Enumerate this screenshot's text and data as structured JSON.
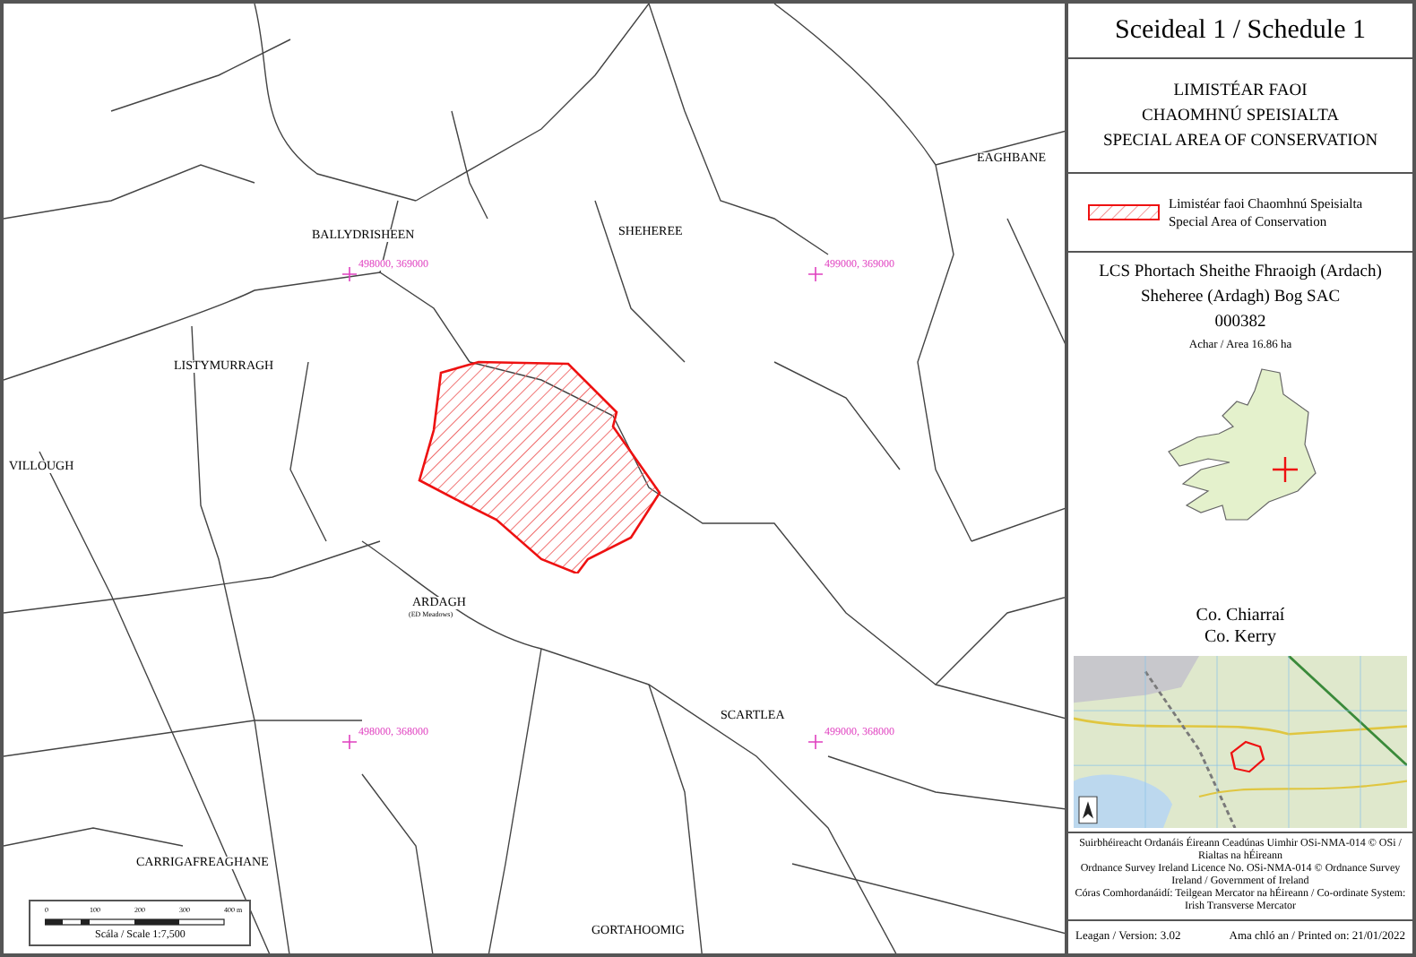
{
  "map": {
    "place_labels": [
      {
        "text": "EAGHBANE"
      },
      {
        "text": "BALLYDRISHEEN"
      },
      {
        "text": "SHEHEREE"
      },
      {
        "text": "LISTYMURRAGH"
      },
      {
        "text": "VILLOUGH"
      },
      {
        "text": "ARDAGH"
      },
      {
        "text": "(ED Meadows)"
      },
      {
        "text": "SCARTLEA"
      },
      {
        "text": "CARRIGAFREAGHANE"
      },
      {
        "text": "GORTAHOOMIG"
      }
    ],
    "grid_labels": [
      {
        "text": "498000, 369000"
      },
      {
        "text": "499000, 369000"
      },
      {
        "text": "498000, 368000"
      },
      {
        "text": "499000, 368000"
      }
    ],
    "scale_bar": {
      "ticks": [
        "0",
        "100",
        "200",
        "300",
        "400 m"
      ],
      "caption": "Scála / Scale 1:7,500"
    }
  },
  "panel": {
    "title": "Sceideal 1 / Schedule 1",
    "heading": [
      "LIMISTÉAR FAOI",
      "CHAOMHNÚ SPEISIALTA",
      "SPECIAL AREA OF CONSERVATION"
    ],
    "legend": [
      "Limistéar faoi Chaomhnú Speisialta",
      "Special Area of Conservation"
    ],
    "site": [
      "LCS Phortach Sheithe Fhraoigh (Ardach)",
      "Sheheree (Ardagh) Bog SAC",
      "000382"
    ],
    "area": "Achar / Area 16.86 ha",
    "county": [
      "Co. Chiarraí",
      "Co. Kerry"
    ],
    "copyright": [
      "Suirbhéireacht Ordanáis Éireann Ceadúnas Uimhir OSi-NMA-014 © OSi / Rialtas na hÉireann",
      "Ordnance Survey Ireland Licence No. OSi-NMA-014 © Ordnance Survey Ireland / Government of Ireland",
      "Córas Comhordanáidí: Teilgean Mercator na hÉireann / Co-ordinate System: Irish Transverse Mercator"
    ],
    "version": "Leagan / Version: 3.02",
    "printed": "Ama chló an / Printed on: 21/01/2022"
  }
}
